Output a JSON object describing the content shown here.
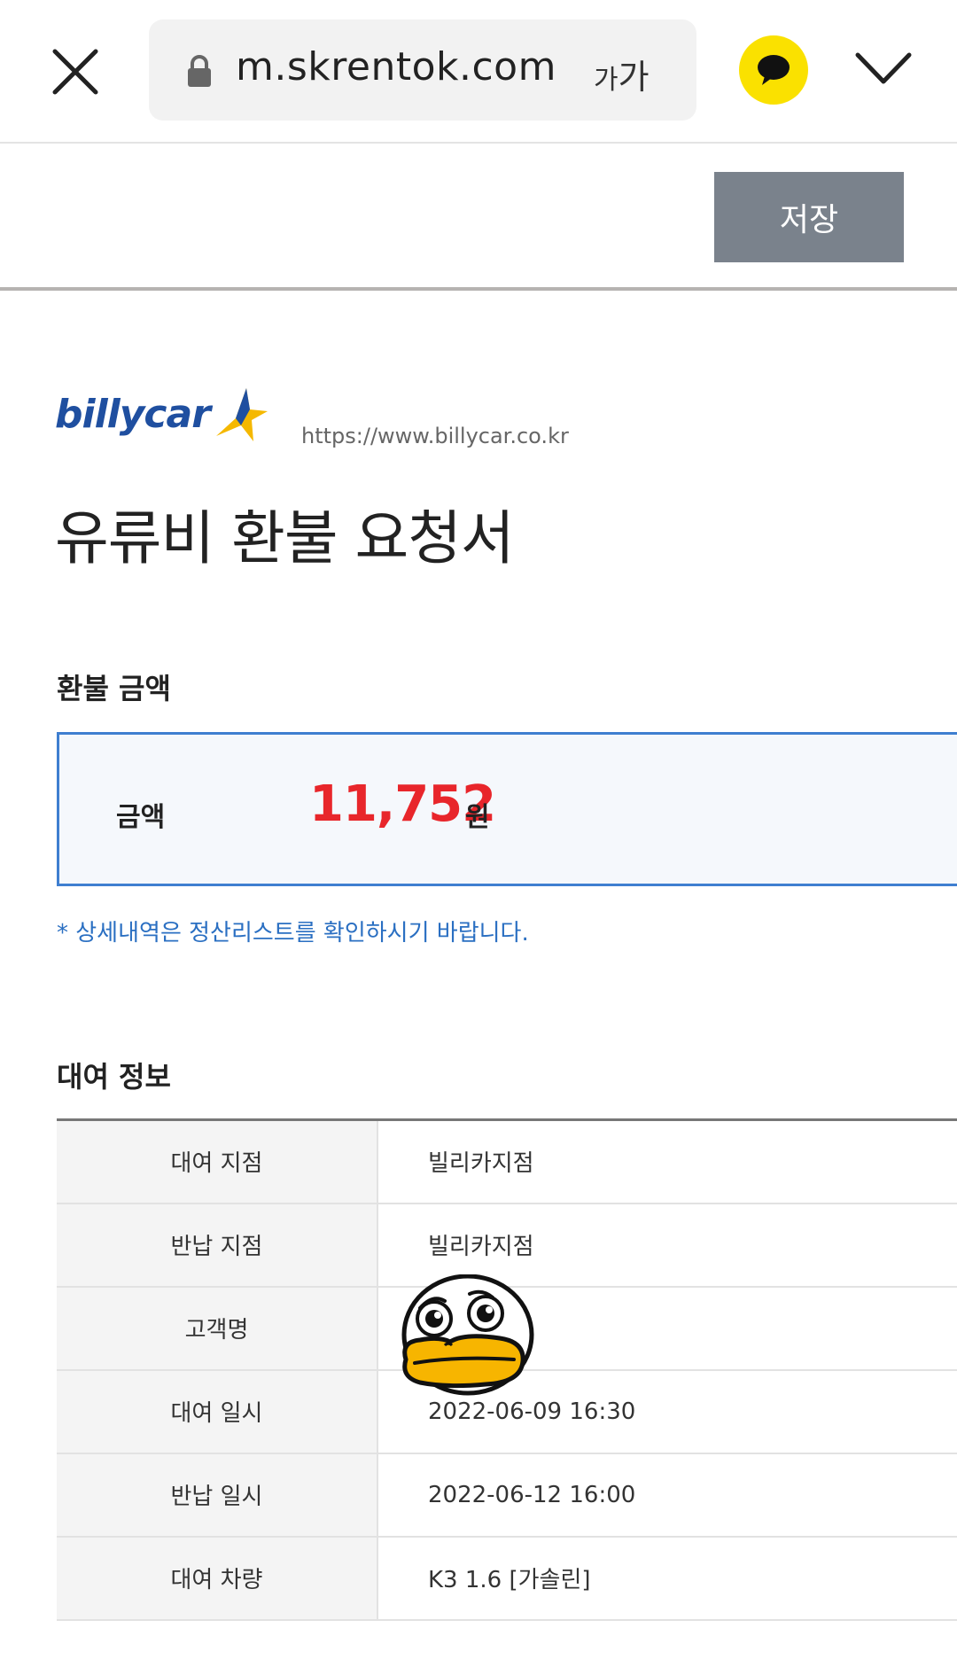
{
  "browser": {
    "url": "m.skrentok.com",
    "font_size_small": "가",
    "font_size_large": "가",
    "kakao_color": "#fae100"
  },
  "toolbar": {
    "save_label": "저장"
  },
  "document": {
    "logo_text": "billycar",
    "site_url": "https://www.billycar.co.kr",
    "title": "유류비 환불 요청서",
    "refund_section_title": "환불 금액",
    "amount_label": "금액",
    "amount_value": "11,752",
    "amount_unit": "원",
    "note": "* 상세내역은 정산리스트를 확인하시기 바랍니다.",
    "rental_section_title": "대여 정보",
    "rental_rows": [
      {
        "label": "대여 지점",
        "value": "빌리카지점"
      },
      {
        "label": "반납 지점",
        "value": "빌리카지점"
      },
      {
        "label": "고객명",
        "value": ""
      },
      {
        "label": "대여 일시",
        "value": "2022-06-09 16:30"
      },
      {
        "label": "반납 일시",
        "value": "2022-06-12 16:00"
      },
      {
        "label": "대여 차량",
        "value": "K3 1.6 [가솔린]"
      }
    ]
  },
  "colors": {
    "accent_blue": "#3f7fd0",
    "amount_red": "#e8262b",
    "save_gray": "#7a828c"
  }
}
